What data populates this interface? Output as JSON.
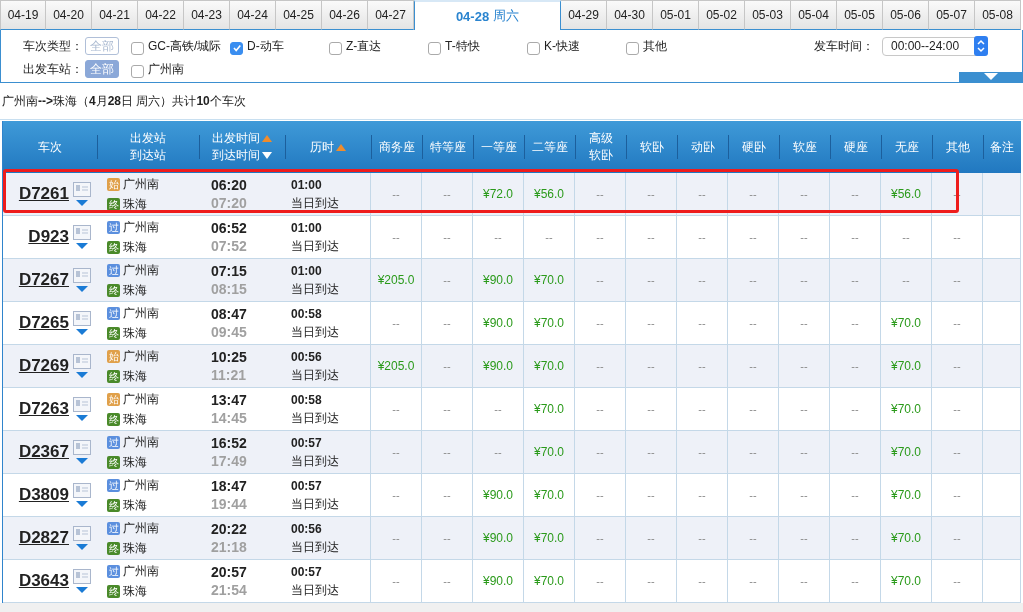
{
  "date_tabs": [
    {
      "date": "04-19",
      "selected": false
    },
    {
      "date": "04-20",
      "selected": false
    },
    {
      "date": "04-21",
      "selected": false
    },
    {
      "date": "04-22",
      "selected": false
    },
    {
      "date": "04-23",
      "selected": false
    },
    {
      "date": "04-24",
      "selected": false
    },
    {
      "date": "04-25",
      "selected": false
    },
    {
      "date": "04-26",
      "selected": false
    },
    {
      "date": "04-27",
      "selected": false
    },
    {
      "date": "04-28",
      "weekday": "周六",
      "selected": true
    },
    {
      "date": "04-29",
      "selected": false
    },
    {
      "date": "04-30",
      "selected": false
    },
    {
      "date": "05-01",
      "selected": false
    },
    {
      "date": "05-02",
      "selected": false
    },
    {
      "date": "05-03",
      "selected": false
    },
    {
      "date": "05-04",
      "selected": false
    },
    {
      "date": "05-05",
      "selected": false
    },
    {
      "date": "05-06",
      "selected": false
    },
    {
      "date": "05-07",
      "selected": false
    },
    {
      "date": "05-08",
      "selected": false
    }
  ],
  "filters": {
    "type_label": "车次类型：",
    "type_all": {
      "label": "全部",
      "selected": false
    },
    "types": [
      {
        "label": "GC-高铁/城际",
        "checked": false
      },
      {
        "label": "D-动车",
        "checked": true
      },
      {
        "label": "Z-直达",
        "checked": false
      },
      {
        "label": "T-特快",
        "checked": false
      },
      {
        "label": "K-快速",
        "checked": false
      },
      {
        "label": "其他",
        "checked": false
      }
    ],
    "station_label": "出发车站：",
    "station_all": {
      "label": "全部",
      "selected": true
    },
    "stations": [
      {
        "label": "广州南",
        "checked": false
      }
    ],
    "time_label": "发车时间：",
    "time_value": "00:00--24:00"
  },
  "summary": "广州南**-->**珠海（**4**月**28**日 周六）共计**10**个车次",
  "table": {
    "columns": [
      {
        "lines": [
          "车次"
        ]
      },
      {
        "lines": [
          "出发站",
          "到达站"
        ]
      },
      {
        "lines": [
          "出发时间",
          "到达时间"
        ],
        "sort_ascending": [
          true,
          false
        ]
      },
      {
        "lines": [
          "历时"
        ],
        "sort_ascending": [
          true
        ]
      },
      {
        "lines": [
          "商务座"
        ]
      },
      {
        "lines": [
          "特等座"
        ]
      },
      {
        "lines": [
          "一等座"
        ]
      },
      {
        "lines": [
          "二等座"
        ]
      },
      {
        "lines": [
          "高级",
          "软卧"
        ]
      },
      {
        "lines": [
          "软卧"
        ]
      },
      {
        "lines": [
          "动卧"
        ]
      },
      {
        "lines": [
          "硬卧"
        ]
      },
      {
        "lines": [
          "软座"
        ]
      },
      {
        "lines": [
          "硬座"
        ]
      },
      {
        "lines": [
          "无座"
        ]
      },
      {
        "lines": [
          "其他"
        ]
      },
      {
        "lines": [
          "备注"
        ]
      }
    ],
    "rows": [
      {
        "train": "D7261",
        "highlighted": true,
        "from": {
          "badge": "始",
          "kind": "start",
          "name": "广州南"
        },
        "to": {
          "badge": "终",
          "kind": "end",
          "name": "珠海"
        },
        "depart": "06:20",
        "arrive": "07:20",
        "duration": "01:00",
        "arrival_day": "当日到达",
        "seats": [
          {
            "price": "--",
            "available": false
          },
          {
            "price": "--",
            "available": false
          },
          {
            "price": "¥72.0",
            "available": true
          },
          {
            "price": "¥56.0",
            "available": true
          },
          {
            "price": "--",
            "available": false
          },
          {
            "price": "--",
            "available": false
          },
          {
            "price": "--",
            "available": false
          },
          {
            "price": "--",
            "available": false
          },
          {
            "price": "--",
            "available": false
          },
          {
            "price": "--",
            "available": false
          },
          {
            "price": "¥56.0",
            "available": true
          }
        ],
        "other": "--"
      },
      {
        "train": "D923",
        "highlighted": false,
        "from": {
          "badge": "过",
          "kind": "pass",
          "name": "广州南"
        },
        "to": {
          "badge": "终",
          "kind": "end",
          "name": "珠海"
        },
        "depart": "06:52",
        "arrive": "07:52",
        "duration": "01:00",
        "arrival_day": "当日到达",
        "seats": [
          {
            "price": "--",
            "available": false
          },
          {
            "price": "--",
            "available": false
          },
          {
            "price": "--",
            "available": false
          },
          {
            "price": "--",
            "available": false
          },
          {
            "price": "--",
            "available": false
          },
          {
            "price": "--",
            "available": false
          },
          {
            "price": "--",
            "available": false
          },
          {
            "price": "--",
            "available": false
          },
          {
            "price": "--",
            "available": false
          },
          {
            "price": "--",
            "available": false
          },
          {
            "price": "--",
            "available": false
          }
        ],
        "other": "--"
      },
      {
        "train": "D7267",
        "highlighted": false,
        "from": {
          "badge": "过",
          "kind": "pass",
          "name": "广州南"
        },
        "to": {
          "badge": "终",
          "kind": "end",
          "name": "珠海"
        },
        "depart": "07:15",
        "arrive": "08:15",
        "duration": "01:00",
        "arrival_day": "当日到达",
        "seats": [
          {
            "price": "¥205.0",
            "available": true
          },
          {
            "price": "--",
            "available": false
          },
          {
            "price": "¥90.0",
            "available": true
          },
          {
            "price": "¥70.0",
            "available": true
          },
          {
            "price": "--",
            "available": false
          },
          {
            "price": "--",
            "available": false
          },
          {
            "price": "--",
            "available": false
          },
          {
            "price": "--",
            "available": false
          },
          {
            "price": "--",
            "available": false
          },
          {
            "price": "--",
            "available": false
          },
          {
            "price": "--",
            "available": false
          }
        ],
        "other": "--"
      },
      {
        "train": "D7265",
        "highlighted": false,
        "from": {
          "badge": "过",
          "kind": "pass",
          "name": "广州南"
        },
        "to": {
          "badge": "终",
          "kind": "end",
          "name": "珠海"
        },
        "depart": "08:47",
        "arrive": "09:45",
        "duration": "00:58",
        "arrival_day": "当日到达",
        "seats": [
          {
            "price": "--",
            "available": false
          },
          {
            "price": "--",
            "available": false
          },
          {
            "price": "¥90.0",
            "available": true
          },
          {
            "price": "¥70.0",
            "available": true
          },
          {
            "price": "--",
            "available": false
          },
          {
            "price": "--",
            "available": false
          },
          {
            "price": "--",
            "available": false
          },
          {
            "price": "--",
            "available": false
          },
          {
            "price": "--",
            "available": false
          },
          {
            "price": "--",
            "available": false
          },
          {
            "price": "¥70.0",
            "available": true
          }
        ],
        "other": "--"
      },
      {
        "train": "D7269",
        "highlighted": false,
        "from": {
          "badge": "始",
          "kind": "start",
          "name": "广州南"
        },
        "to": {
          "badge": "终",
          "kind": "end",
          "name": "珠海"
        },
        "depart": "10:25",
        "arrive": "11:21",
        "duration": "00:56",
        "arrival_day": "当日到达",
        "seats": [
          {
            "price": "¥205.0",
            "available": true
          },
          {
            "price": "--",
            "available": false
          },
          {
            "price": "¥90.0",
            "available": true
          },
          {
            "price": "¥70.0",
            "available": true
          },
          {
            "price": "--",
            "available": false
          },
          {
            "price": "--",
            "available": false
          },
          {
            "price": "--",
            "available": false
          },
          {
            "price": "--",
            "available": false
          },
          {
            "price": "--",
            "available": false
          },
          {
            "price": "--",
            "available": false
          },
          {
            "price": "¥70.0",
            "available": true
          }
        ],
        "other": "--"
      },
      {
        "train": "D7263",
        "highlighted": false,
        "from": {
          "badge": "始",
          "kind": "start",
          "name": "广州南"
        },
        "to": {
          "badge": "终",
          "kind": "end",
          "name": "珠海"
        },
        "depart": "13:47",
        "arrive": "14:45",
        "duration": "00:58",
        "arrival_day": "当日到达",
        "seats": [
          {
            "price": "--",
            "available": false
          },
          {
            "price": "--",
            "available": false
          },
          {
            "price": "--",
            "available": false
          },
          {
            "price": "¥70.0",
            "available": true
          },
          {
            "price": "--",
            "available": false
          },
          {
            "price": "--",
            "available": false
          },
          {
            "price": "--",
            "available": false
          },
          {
            "price": "--",
            "available": false
          },
          {
            "price": "--",
            "available": false
          },
          {
            "price": "--",
            "available": false
          },
          {
            "price": "¥70.0",
            "available": true
          }
        ],
        "other": "--"
      },
      {
        "train": "D2367",
        "highlighted": false,
        "from": {
          "badge": "过",
          "kind": "pass",
          "name": "广州南"
        },
        "to": {
          "badge": "终",
          "kind": "end",
          "name": "珠海"
        },
        "depart": "16:52",
        "arrive": "17:49",
        "duration": "00:57",
        "arrival_day": "当日到达",
        "seats": [
          {
            "price": "--",
            "available": false
          },
          {
            "price": "--",
            "available": false
          },
          {
            "price": "--",
            "available": false
          },
          {
            "price": "¥70.0",
            "available": true
          },
          {
            "price": "--",
            "available": false
          },
          {
            "price": "--",
            "available": false
          },
          {
            "price": "--",
            "available": false
          },
          {
            "price": "--",
            "available": false
          },
          {
            "price": "--",
            "available": false
          },
          {
            "price": "--",
            "available": false
          },
          {
            "price": "¥70.0",
            "available": true
          }
        ],
        "other": "--"
      },
      {
        "train": "D3809",
        "highlighted": false,
        "from": {
          "badge": "过",
          "kind": "pass",
          "name": "广州南"
        },
        "to": {
          "badge": "终",
          "kind": "end",
          "name": "珠海"
        },
        "depart": "18:47",
        "arrive": "19:44",
        "duration": "00:57",
        "arrival_day": "当日到达",
        "seats": [
          {
            "price": "--",
            "available": false
          },
          {
            "price": "--",
            "available": false
          },
          {
            "price": "¥90.0",
            "available": true
          },
          {
            "price": "¥70.0",
            "available": true
          },
          {
            "price": "--",
            "available": false
          },
          {
            "price": "--",
            "available": false
          },
          {
            "price": "--",
            "available": false
          },
          {
            "price": "--",
            "available": false
          },
          {
            "price": "--",
            "available": false
          },
          {
            "price": "--",
            "available": false
          },
          {
            "price": "¥70.0",
            "available": true
          }
        ],
        "other": "--"
      },
      {
        "train": "D2827",
        "highlighted": false,
        "from": {
          "badge": "过",
          "kind": "pass",
          "name": "广州南"
        },
        "to": {
          "badge": "终",
          "kind": "end",
          "name": "珠海"
        },
        "depart": "20:22",
        "arrive": "21:18",
        "duration": "00:56",
        "arrival_day": "当日到达",
        "seats": [
          {
            "price": "--",
            "available": false
          },
          {
            "price": "--",
            "available": false
          },
          {
            "price": "¥90.0",
            "available": true
          },
          {
            "price": "¥70.0",
            "available": true
          },
          {
            "price": "--",
            "available": false
          },
          {
            "price": "--",
            "available": false
          },
          {
            "price": "--",
            "available": false
          },
          {
            "price": "--",
            "available": false
          },
          {
            "price": "--",
            "available": false
          },
          {
            "price": "--",
            "available": false
          },
          {
            "price": "¥70.0",
            "available": true
          }
        ],
        "other": "--"
      },
      {
        "train": "D3643",
        "highlighted": false,
        "from": {
          "badge": "过",
          "kind": "pass",
          "name": "广州南"
        },
        "to": {
          "badge": "终",
          "kind": "end",
          "name": "珠海"
        },
        "depart": "20:57",
        "arrive": "21:54",
        "duration": "00:57",
        "arrival_day": "当日到达",
        "seats": [
          {
            "price": "--",
            "available": false
          },
          {
            "price": "--",
            "available": false
          },
          {
            "price": "¥90.0",
            "available": true
          },
          {
            "price": "¥70.0",
            "available": true
          },
          {
            "price": "--",
            "available": false
          },
          {
            "price": "--",
            "available": false
          },
          {
            "price": "--",
            "available": false
          },
          {
            "price": "--",
            "available": false
          },
          {
            "price": "--",
            "available": false
          },
          {
            "price": "--",
            "available": false
          },
          {
            "price": "¥70.0",
            "available": true
          }
        ],
        "other": "--"
      }
    ]
  }
}
